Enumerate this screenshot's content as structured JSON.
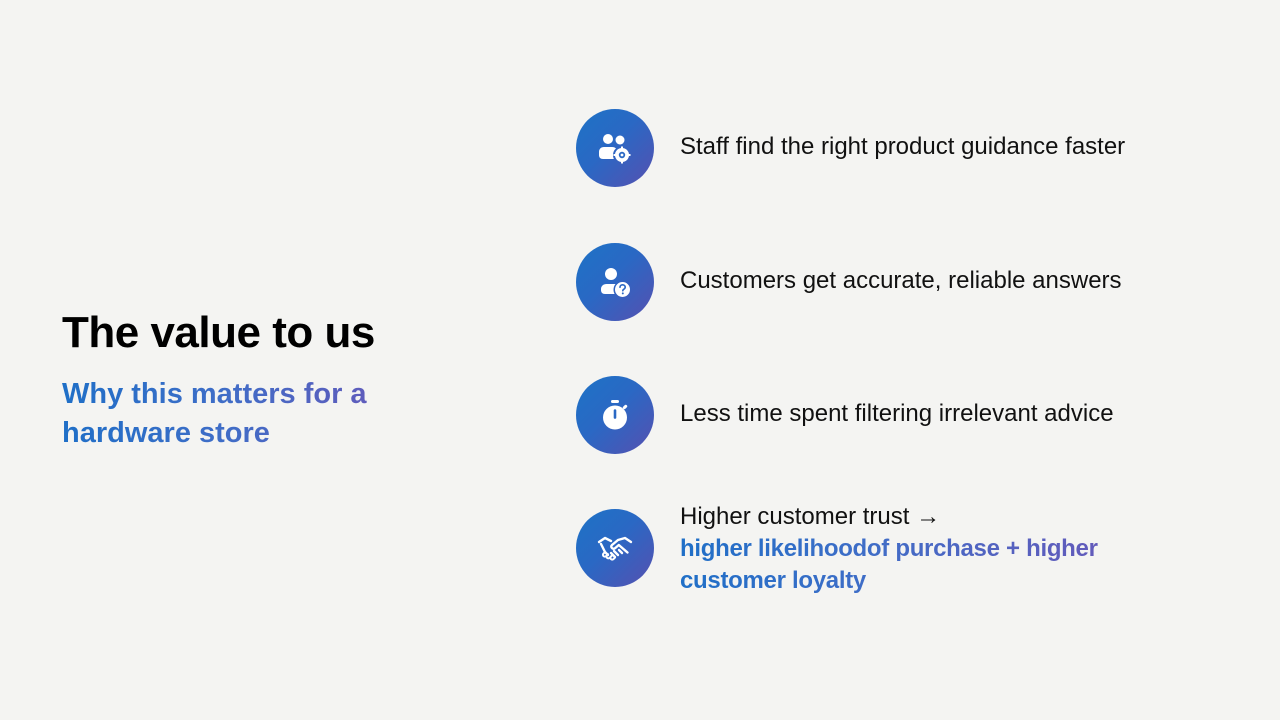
{
  "slide": {
    "title": "The value to us",
    "subtitle": "Why this matters for a hardware store"
  },
  "items": [
    {
      "icon": "team-gear-icon",
      "text": "Staff find the right product guidance faster"
    },
    {
      "icon": "person-question-icon",
      "text": "Customers get accurate, reliable answers"
    },
    {
      "icon": "stopwatch-icon",
      "text": "Less time spent filtering irrelevant advice"
    },
    {
      "icon": "handshake-icon",
      "text": "Higher customer trust →",
      "highlight": "higher likelihoodof purchase + higher customer loyalty"
    }
  ],
  "colors": {
    "background": "#f4f4f2",
    "accent_start": "#1f6fc7",
    "accent_end": "#6a56b8",
    "text": "#111111"
  }
}
